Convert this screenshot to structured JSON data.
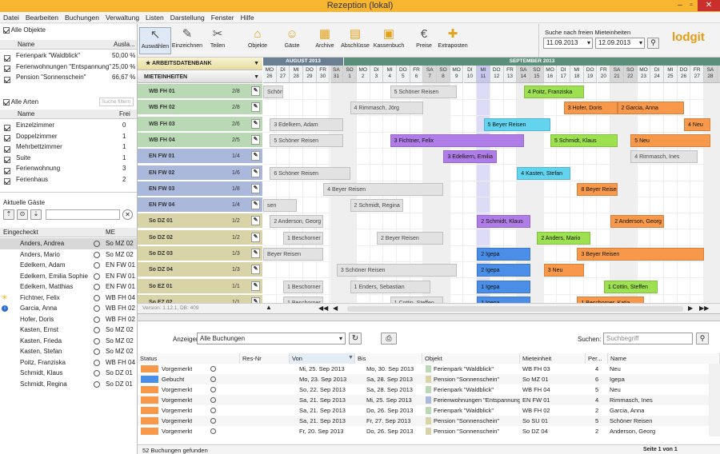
{
  "window": {
    "title": "Rezeption (lokal)"
  },
  "menu": [
    "Datei",
    "Bearbeiten",
    "Buchungen",
    "Verwaltung",
    "Listen",
    "Darstellung",
    "Fenster",
    "Hilfe"
  ],
  "objects": {
    "all_label": "Alle Objekte",
    "col_name": "Name",
    "col_util": "Ausla...",
    "items": [
      {
        "name": "Ferienpark \"Waldblick\"",
        "value": "50,00 %"
      },
      {
        "name": "Ferienwohnungen \"Entspannung\"",
        "value": "25,00 %"
      },
      {
        "name": "Pension \"Sonnenschein\"",
        "value": "66,67 %"
      }
    ]
  },
  "types": {
    "all_label": "Alle Arten",
    "filter_placeholder": "Suche filtern",
    "col_name": "Name",
    "col_free": "Frei",
    "items": [
      {
        "name": "Einzelzimmer",
        "free": "0"
      },
      {
        "name": "Doppelzimmer",
        "free": "1"
      },
      {
        "name": "Mehrbettzimmer",
        "free": "1"
      },
      {
        "name": "Suite",
        "free": "1"
      },
      {
        "name": "Ferienwohnung",
        "free": "3"
      },
      {
        "name": "Ferienhaus",
        "free": "2"
      }
    ]
  },
  "guests": {
    "title": "Aktuelle Gäste",
    "col_in": "Eingecheckt",
    "col_unit": "ME",
    "items": [
      {
        "name": "Anders, Andrea",
        "unit": "So MZ 02",
        "mark": ""
      },
      {
        "name": "Anders, Mario",
        "unit": "So MZ 02",
        "mark": ""
      },
      {
        "name": "Edelkern, Adam",
        "unit": "EN FW 01",
        "mark": ""
      },
      {
        "name": "Edelkern, Emilia Sophie",
        "unit": "EN FW 01",
        "mark": ""
      },
      {
        "name": "Edelkern, Matthias",
        "unit": "EN FW 01",
        "mark": ""
      },
      {
        "name": "Fichtner, Felix",
        "unit": "WB FH 04",
        "mark": "sun"
      },
      {
        "name": "Garcia, Anna",
        "unit": "WB FH 02",
        "mark": "info"
      },
      {
        "name": "Hofer, Doris",
        "unit": "WB FH 02",
        "mark": ""
      },
      {
        "name": "Kasten, Ernst",
        "unit": "So MZ 02",
        "mark": ""
      },
      {
        "name": "Kasten, Frieda",
        "unit": "So MZ 02",
        "mark": ""
      },
      {
        "name": "Kasten, Stefan",
        "unit": "So MZ 02",
        "mark": ""
      },
      {
        "name": "Poitz, Franziska",
        "unit": "WB FH 04",
        "mark": ""
      },
      {
        "name": "Schmidt, Klaus",
        "unit": "So DZ 01",
        "mark": ""
      },
      {
        "name": "Schmidt, Regina",
        "unit": "So DZ 01",
        "mark": ""
      }
    ]
  },
  "toolbar": {
    "buttons": [
      "Auswählen",
      "Einzeichnen",
      "Teilen",
      "Objekte",
      "Gäste",
      "Archive",
      "Abschlüsse",
      "Kassenbuch",
      "Preise",
      "Extraposten"
    ],
    "search_label": "Suche nach freien Mieteinheiten",
    "date_from": "11.09.2013",
    "date_to": "12.09.2013",
    "logo": "lodgit"
  },
  "calendar": {
    "panel1": "ARBEITSDATENBANK",
    "panel2": "MIETEINHEITEN",
    "month1": "AUGUST 2013",
    "month2": "SEPTEMBER 2013",
    "days": [
      [
        "MO",
        "26"
      ],
      [
        "DI",
        "27"
      ],
      [
        "MI",
        "28"
      ],
      [
        "DO",
        "29"
      ],
      [
        "FR",
        "30"
      ],
      [
        "SA",
        "31"
      ],
      [
        "SO",
        "1"
      ],
      [
        "MO",
        "2"
      ],
      [
        "DI",
        "3"
      ],
      [
        "MI",
        "4"
      ],
      [
        "DO",
        "5"
      ],
      [
        "FR",
        "6"
      ],
      [
        "SA",
        "7"
      ],
      [
        "SO",
        "8"
      ],
      [
        "MO",
        "9"
      ],
      [
        "DI",
        "10"
      ],
      [
        "MI",
        "11"
      ],
      [
        "DO",
        "12"
      ],
      [
        "FR",
        "13"
      ],
      [
        "SA",
        "14"
      ],
      [
        "SO",
        "15"
      ],
      [
        "MO",
        "16"
      ],
      [
        "DI",
        "17"
      ],
      [
        "MI",
        "18"
      ],
      [
        "DO",
        "19"
      ],
      [
        "FR",
        "20"
      ],
      [
        "SA",
        "21"
      ],
      [
        "SO",
        "22"
      ],
      [
        "MO",
        "23"
      ],
      [
        "DI",
        "24"
      ],
      [
        "MI",
        "25"
      ],
      [
        "DO",
        "26"
      ],
      [
        "FR",
        "27"
      ],
      [
        "SA",
        "28"
      ],
      [
        "SO",
        "29"
      ]
    ],
    "version": "Version: 1.12.1, DB: 409",
    "units": [
      {
        "name": "WB FH 01",
        "frac": "2/8",
        "group": "wb"
      },
      {
        "name": "WB FH 02",
        "frac": "2/8",
        "group": "wb"
      },
      {
        "name": "WB FH 03",
        "frac": "2/6",
        "group": "wb"
      },
      {
        "name": "WB FH 04",
        "frac": "2/5",
        "group": "wb"
      },
      {
        "name": "EN FW 01",
        "frac": "1/4",
        "group": "en"
      },
      {
        "name": "EN FW 02",
        "frac": "1/6",
        "group": "en"
      },
      {
        "name": "EN FW 03",
        "frac": "1/8",
        "group": "en"
      },
      {
        "name": "EN FW 04",
        "frac": "1/4",
        "group": "en"
      },
      {
        "name": "So DZ 01",
        "frac": "1/2",
        "group": "so"
      },
      {
        "name": "So DZ 02",
        "frac": "1/2",
        "group": "so"
      },
      {
        "name": "So DZ 03",
        "frac": "1/3",
        "group": "so"
      },
      {
        "name": "So DZ 04",
        "frac": "1/3",
        "group": "so"
      },
      {
        "name": "So EZ 01",
        "frac": "1/1",
        "group": "so"
      },
      {
        "name": "So EZ 02",
        "frac": "1/1",
        "group": "so"
      }
    ],
    "bookings": [
      {
        "r": 0,
        "s": 0,
        "e": 1.5,
        "t": "Schöner Reisen",
        "c": "gray"
      },
      {
        "r": 0,
        "s": 9.5,
        "e": 14.5,
        "t": "5 Schöner Reisen",
        "c": "gray"
      },
      {
        "r": 0,
        "s": 19.5,
        "e": 24,
        "t": "4 Poitz, Franziska",
        "c": "green"
      },
      {
        "r": 1,
        "s": 6.5,
        "e": 12,
        "t": "4 Rimmasch, Jörg",
        "c": "gray"
      },
      {
        "r": 1,
        "s": 22.5,
        "e": 26.5,
        "t": "3 Hofer, Doris",
        "c": "orange"
      },
      {
        "r": 1,
        "s": 26.5,
        "e": 31.5,
        "t": "2 Garcia, Anna",
        "c": "orange"
      },
      {
        "r": 2,
        "s": 0.5,
        "e": 6,
        "t": "3 Edelkern, Adam",
        "c": "gray"
      },
      {
        "r": 2,
        "s": 16.5,
        "e": 21.5,
        "t": "5 Beyer Reisen",
        "c": "cyan"
      },
      {
        "r": 2,
        "s": 31.5,
        "e": 33.5,
        "t": "4 Neu",
        "c": "orange"
      },
      {
        "r": 3,
        "s": 0.5,
        "e": 6,
        "t": "5 Schöner Reisen",
        "c": "gray"
      },
      {
        "r": 3,
        "s": 9.5,
        "e": 19.5,
        "t": "3 Fichtner, Felix",
        "c": "purple"
      },
      {
        "r": 3,
        "s": 21.5,
        "e": 26.5,
        "t": "5 Schmidt, Klaus",
        "c": "green"
      },
      {
        "r": 3,
        "s": 27.5,
        "e": 33.5,
        "t": "5 Neu",
        "c": "orange"
      },
      {
        "r": 4,
        "s": 13.5,
        "e": 17.5,
        "t": "3 Edelkern, Emilia",
        "c": "purple"
      },
      {
        "r": 4,
        "s": 27.5,
        "e": 32.5,
        "t": "4 Rimmasch, Ines",
        "c": "gray"
      },
      {
        "r": 5,
        "s": 0.5,
        "e": 6.5,
        "t": "6 Schöner Reisen",
        "c": "gray"
      },
      {
        "r": 5,
        "s": 19,
        "e": 23,
        "t": "4 Kasten, Stefan",
        "c": "cyan"
      },
      {
        "r": 6,
        "s": 4.5,
        "e": 13.5,
        "t": "4 Beyer Reisen",
        "c": "gray"
      },
      {
        "r": 6,
        "s": 23.5,
        "e": 26.5,
        "t": "8 Beyer Reisen",
        "c": "orange"
      },
      {
        "r": 7,
        "s": 0,
        "e": 2.5,
        "t": "sen",
        "c": "gray"
      },
      {
        "r": 7,
        "s": 6.5,
        "e": 10.5,
        "t": "2 Schmidt, Regina",
        "c": "gray"
      },
      {
        "r": 8,
        "s": 0.5,
        "e": 4.5,
        "t": "2 Anderson, Georg",
        "c": "gray"
      },
      {
        "r": 8,
        "s": 16,
        "e": 20,
        "t": "2 Schmidt, Klaus",
        "c": "purple"
      },
      {
        "r": 8,
        "s": 26,
        "e": 30,
        "t": "2 Anderson, Georg",
        "c": "orange"
      },
      {
        "r": 9,
        "s": 1.5,
        "e": 4.5,
        "t": "1 Beschorner",
        "c": "gray"
      },
      {
        "r": 9,
        "s": 8.5,
        "e": 13.5,
        "t": "2 Beyer Reisen",
        "c": "gray"
      },
      {
        "r": 9,
        "s": 20.5,
        "e": 24.5,
        "t": "2 Anders, Mario",
        "c": "green"
      },
      {
        "r": 10,
        "s": 0,
        "e": 4.5,
        "t": "Beyer Reisen",
        "c": "gray"
      },
      {
        "r": 10,
        "s": 16,
        "e": 20,
        "t": "2 Igepa",
        "c": "blue"
      },
      {
        "r": 10,
        "s": 23.5,
        "e": 33,
        "t": "3 Beyer Reisen",
        "c": "orange"
      },
      {
        "r": 11,
        "s": 5.5,
        "e": 14.5,
        "t": "3 Schöner Reisen",
        "c": "gray"
      },
      {
        "r": 11,
        "s": 16,
        "e": 20,
        "t": "2 Igepa",
        "c": "blue"
      },
      {
        "r": 11,
        "s": 21,
        "e": 24,
        "t": "3 Neu",
        "c": "orange"
      },
      {
        "r": 12,
        "s": 1.5,
        "e": 4.5,
        "t": "1 Beschorner",
        "c": "gray"
      },
      {
        "r": 12,
        "s": 6.5,
        "e": 12.5,
        "t": "1 Enders, Sebastian",
        "c": "gray"
      },
      {
        "r": 12,
        "s": 16,
        "e": 20,
        "t": "1 Igepa",
        "c": "blue"
      },
      {
        "r": 12,
        "s": 25.5,
        "e": 29.5,
        "t": "1 Cottin, Steffen",
        "c": "green"
      },
      {
        "r": 13,
        "s": 1.5,
        "e": 4.5,
        "t": "1 Beschorner",
        "c": "gray"
      },
      {
        "r": 13,
        "s": 9.5,
        "e": 13.5,
        "t": "1 Cottin, Steffen",
        "c": "gray"
      },
      {
        "r": 13,
        "s": 16,
        "e": 20,
        "t": "1 Igepa",
        "c": "blue"
      },
      {
        "r": 13,
        "s": 23.5,
        "e": 28.5,
        "t": "1 Beschorner, Katja",
        "c": "orange"
      }
    ]
  },
  "list": {
    "show_label": "Anzeigen:",
    "filter": "Alle Buchungen",
    "search_label": "Suchen:",
    "search_placeholder": "Suchbegriff",
    "cols": [
      "Status",
      "Res-Nr",
      "Von",
      "Bis",
      "Objekt",
      "Mieteinheit",
      "Per...",
      "Name"
    ],
    "rows": [
      {
        "status": "Vorgemerkt",
        "c": "orange",
        "von": "Mi, 25. Sep 2013",
        "bis": "Mo, 30. Sep 2013",
        "obj": "Ferienpark \"Waldblick\"",
        "oc": "wb",
        "unit": "WB FH 03",
        "per": "4",
        "name": "Neu"
      },
      {
        "status": "Gebucht",
        "c": "blue",
        "von": "Mo, 23. Sep 2013",
        "bis": "Sa, 28. Sep 2013",
        "obj": "Pension \"Sonnenschein\"",
        "oc": "so",
        "unit": "So MZ 01",
        "per": "6",
        "name": "Igepa"
      },
      {
        "status": "Vorgemerkt",
        "c": "orange",
        "von": "So, 22. Sep 2013",
        "bis": "Sa, 28. Sep 2013",
        "obj": "Ferienpark \"Waldblick\"",
        "oc": "wb",
        "unit": "WB FH 04",
        "per": "5",
        "name": "Neu"
      },
      {
        "status": "Vorgemerkt",
        "c": "orange",
        "von": "Sa, 21. Sep 2013",
        "bis": "Mi, 25. Sep 2013",
        "obj": "Ferienwohnungen \"Entspannung\"",
        "oc": "en",
        "unit": "EN FW 01",
        "per": "4",
        "name": "Rimmasch, Ines"
      },
      {
        "status": "Vorgemerkt",
        "c": "orange",
        "von": "Sa, 21. Sep 2013",
        "bis": "Do, 26. Sep 2013",
        "obj": "Ferienpark \"Waldblick\"",
        "oc": "wb",
        "unit": "WB FH 02",
        "per": "2",
        "name": "Garcia, Anna"
      },
      {
        "status": "Vorgemerkt",
        "c": "orange",
        "von": "Sa, 21. Sep 2013",
        "bis": "Fr, 27. Sep 2013",
        "obj": "Pension \"Sonnenschein\"",
        "oc": "so",
        "unit": "So SU 01",
        "per": "5",
        "name": "Schöner Reisen"
      },
      {
        "status": "Vorgemerkt",
        "c": "orange",
        "von": "Fr, 20. Sep 2013",
        "bis": "Do, 26. Sep 2013",
        "obj": "Pension \"Sonnenschein\"",
        "oc": "so",
        "unit": "So DZ 04",
        "per": "2",
        "name": "Anderson, Georg"
      }
    ],
    "count": "52 Buchungen gefunden",
    "page": "Seite 1 von 1"
  },
  "colors": {
    "gray": "#e2e2e2",
    "green": "#9de050",
    "orange": "#f7984a",
    "purple": "#b07de8",
    "cyan": "#62d4ef",
    "blue": "#4b8ee8",
    "wb": "#b9d9b4",
    "en": "#aab8dc",
    "so": "#d9d3a8"
  }
}
